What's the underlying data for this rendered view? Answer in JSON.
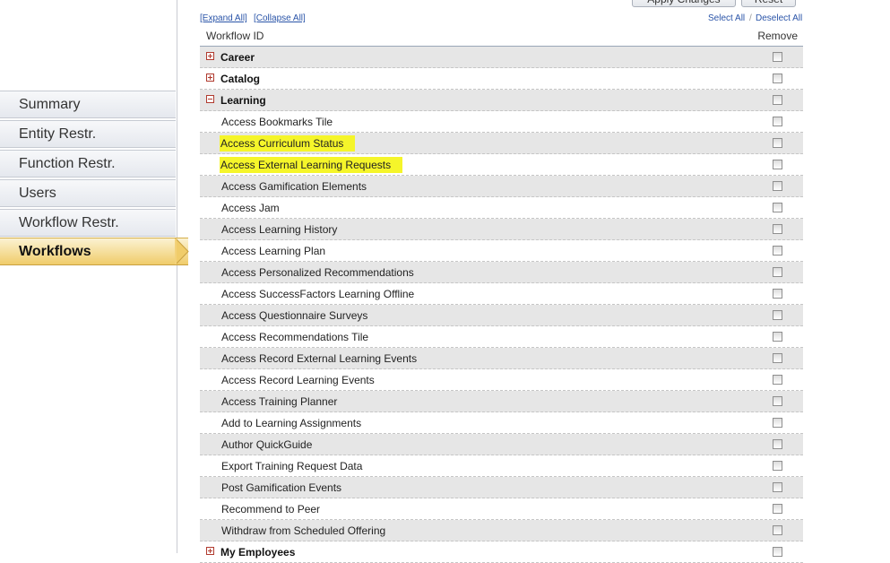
{
  "sidebar": {
    "items": [
      {
        "label": "Summary"
      },
      {
        "label": "Entity Restr."
      },
      {
        "label": "Function Restr."
      },
      {
        "label": "Users"
      },
      {
        "label": "Workflow Restr."
      },
      {
        "label": "Workflows",
        "active": true
      }
    ]
  },
  "toolbar": {
    "apply_label": "Apply Changes",
    "reset_label": "Reset",
    "expand_all": "[Expand All]",
    "collapse_all": "[Collapse All]",
    "select_all": "Select All",
    "deselect_all": "Deselect All"
  },
  "table": {
    "col_workflow": "Workflow ID",
    "col_remove": "Remove",
    "rows": [
      {
        "label": "Career",
        "group": true,
        "expanded": false
      },
      {
        "label": "Catalog",
        "group": true,
        "expanded": false
      },
      {
        "label": "Learning",
        "group": true,
        "expanded": true
      },
      {
        "label": "Access Bookmarks Tile"
      },
      {
        "label": "Access Curriculum Status",
        "highlight": true
      },
      {
        "label": "Access External Learning Requests",
        "highlight": true
      },
      {
        "label": "Access Gamification Elements"
      },
      {
        "label": "Access Jam"
      },
      {
        "label": "Access Learning History"
      },
      {
        "label": "Access Learning Plan"
      },
      {
        "label": "Access Personalized Recommendations"
      },
      {
        "label": "Access SuccessFactors Learning Offline"
      },
      {
        "label": "Access Questionnaire Surveys"
      },
      {
        "label": "Access Recommendations Tile"
      },
      {
        "label": "Access Record External Learning Events"
      },
      {
        "label": "Access Record Learning Events"
      },
      {
        "label": "Access Training Planner"
      },
      {
        "label": "Add to Learning Assignments"
      },
      {
        "label": "Author QuickGuide"
      },
      {
        "label": "Export Training Request Data"
      },
      {
        "label": "Post Gamification Events"
      },
      {
        "label": "Recommend to Peer"
      },
      {
        "label": "Withdraw from Scheduled Offering"
      },
      {
        "label": "My Employees",
        "group": true,
        "expanded": false
      }
    ]
  },
  "colors": {
    "highlight": "#f5f52a",
    "active_nav": "#f0cc6a",
    "link": "#2a54a8",
    "toggle": "#b03a2e"
  }
}
